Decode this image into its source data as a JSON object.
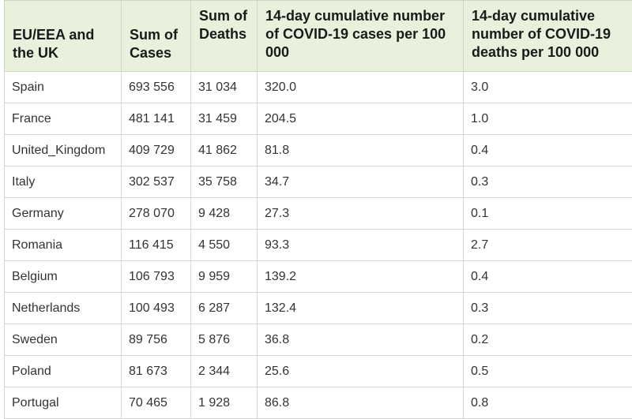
{
  "table": {
    "headers": [
      "EU/EEA and the UK",
      "Sum of Cases",
      "Sum of Deaths",
      "14-day cumulative number of COVID-19 cases per 100 000",
      "14-day cumulative number of COVID-19 deaths per 100 000"
    ],
    "rows": [
      [
        "Spain",
        "693 556",
        "31 034",
        "320.0",
        "3.0"
      ],
      [
        "France",
        "481 141",
        "31 459",
        "204.5",
        "1.0"
      ],
      [
        "United_Kingdom",
        "409 729",
        "41 862",
        "81.8",
        "0.4"
      ],
      [
        "Italy",
        "302 537",
        "35 758",
        "34.7",
        "0.3"
      ],
      [
        "Germany",
        "278 070",
        "9 428",
        "27.3",
        "0.1"
      ],
      [
        "Romania",
        "116 415",
        "4 550",
        "93.3",
        "2.7"
      ],
      [
        "Belgium",
        "106 793",
        "9 959",
        "139.2",
        "0.4"
      ],
      [
        "Netherlands",
        "100 493",
        "6 287",
        "132.4",
        "0.3"
      ],
      [
        "Sweden",
        "89 756",
        "5 876",
        "36.8",
        "0.2"
      ],
      [
        "Poland",
        "81 673",
        "2 344",
        "25.6",
        "0.5"
      ],
      [
        "Portugal",
        "70 465",
        "1 928",
        "86.8",
        "0.8"
      ]
    ]
  }
}
